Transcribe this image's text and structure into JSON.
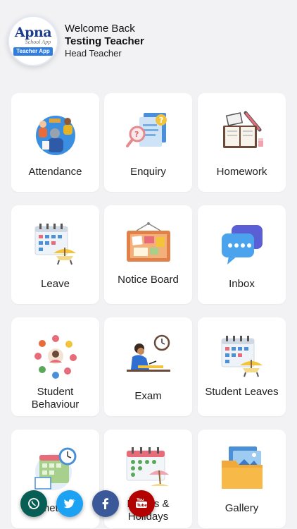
{
  "header": {
    "logo_text": "Apna",
    "logo_sub": "School App",
    "logo_badge": "Teacher App",
    "welcome": "Welcome Back",
    "name": "Testing Teacher",
    "role": "Head Teacher"
  },
  "tiles": [
    {
      "label": "Attendance",
      "icon": "attendance-icon"
    },
    {
      "label": "Enquiry",
      "icon": "enquiry-icon"
    },
    {
      "label": "Homework",
      "icon": "homework-icon"
    },
    {
      "label": "Leave",
      "icon": "leave-calendar-icon"
    },
    {
      "label": "Notice Board",
      "icon": "notice-board-icon"
    },
    {
      "label": "Inbox",
      "icon": "chat-bubbles-icon"
    },
    {
      "label": "Student Behaviour",
      "icon": "behaviour-icon"
    },
    {
      "label": "Exam",
      "icon": "exam-icon"
    },
    {
      "label": "Student Leaves",
      "icon": "student-leaves-calendar-icon"
    },
    {
      "label": "Timetable",
      "icon": "timetable-icon"
    },
    {
      "label": "Events & Holidays",
      "icon": "events-holidays-icon"
    },
    {
      "label": "Gallery",
      "icon": "gallery-icon"
    }
  ],
  "fabs": [
    {
      "name": "whatsapp",
      "color": "#075e54"
    },
    {
      "name": "twitter",
      "color": "#1da1f2"
    },
    {
      "name": "facebook",
      "color": "#3b5998"
    },
    {
      "name": "youtube",
      "color": "#b30000"
    }
  ],
  "colors": {
    "background": "#f2f2f4",
    "card": "#ffffff",
    "brand": "#1f3d8f",
    "badge": "#2f7de1"
  }
}
